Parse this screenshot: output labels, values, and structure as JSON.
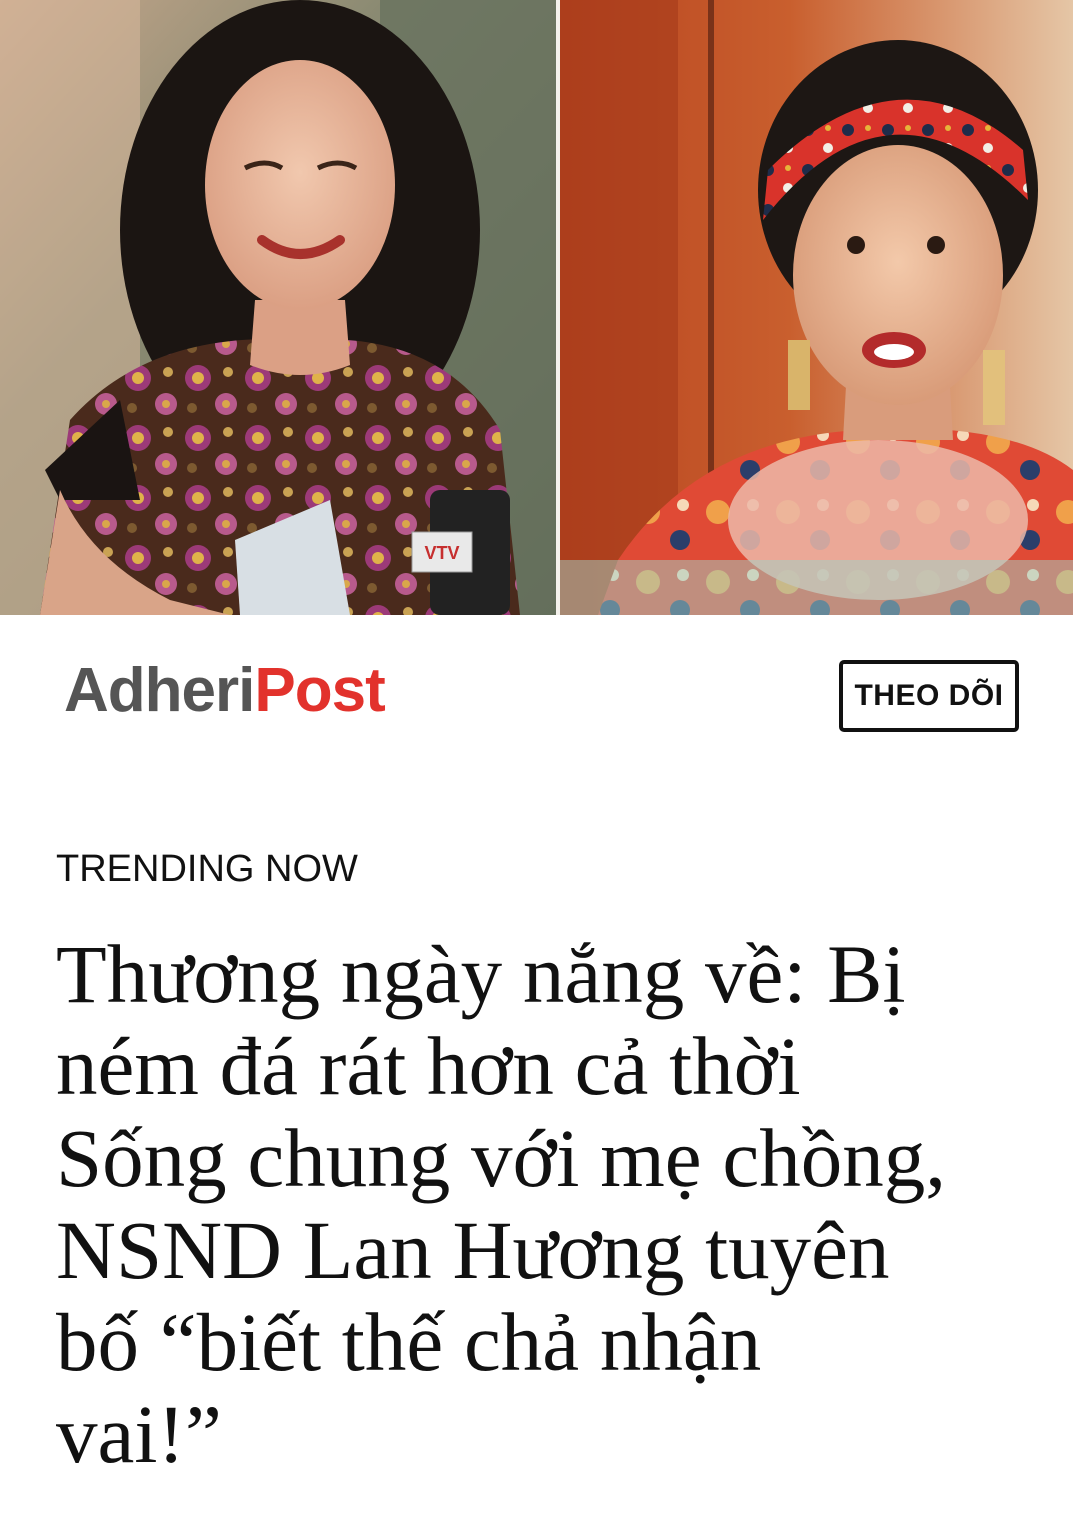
{
  "hero": {
    "left_image": "photo-woman-floral-dress-microphones",
    "right_image": "photo-woman-red-headband-tv-scene",
    "mic_badge": "VTV"
  },
  "brand": {
    "logo_part1": "Adheri",
    "logo_part2": "Post",
    "logo_color_gray": "#555555",
    "logo_color_red": "#e2322c",
    "follow_label": "THEO DÕI"
  },
  "article": {
    "section_label": "TRENDING NOW",
    "headline_lines": [
      "Thương ngày nắng về: Bị",
      "ném đá rát hơn cả thời",
      "Sống chung với mẹ chồng,",
      "NSND Lan Hương tuyên",
      "bố “biết thế chả nhận",
      "vai!”"
    ]
  }
}
